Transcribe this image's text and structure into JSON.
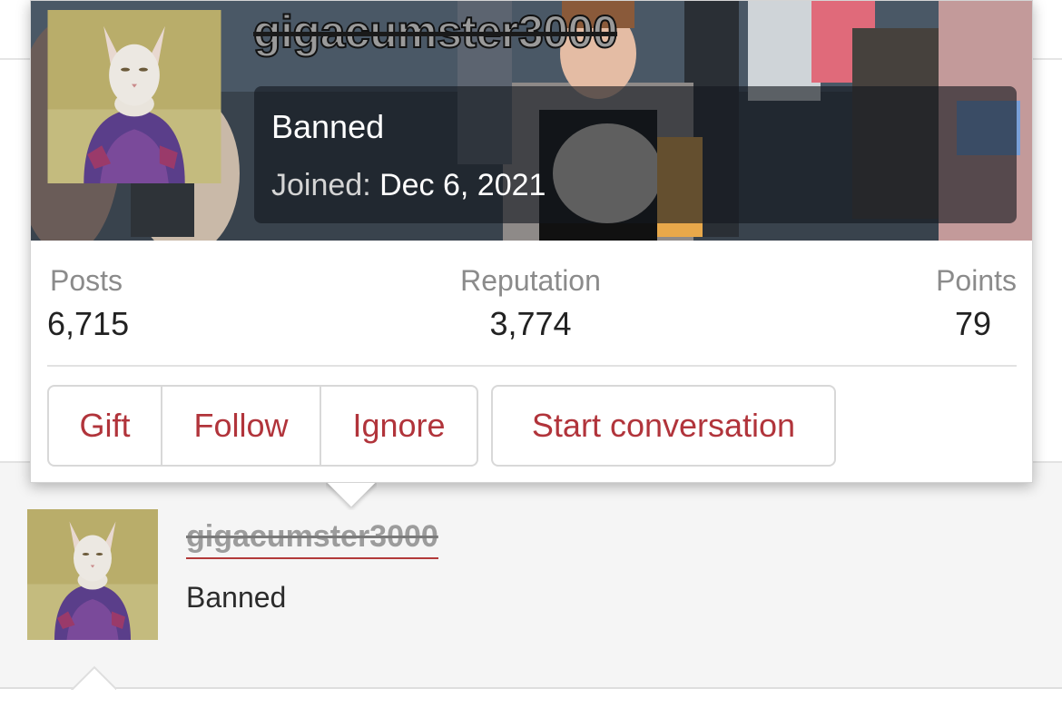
{
  "tooltip": {
    "username": "gigacumster3000",
    "status": "Banned",
    "joined_label": "Joined:",
    "joined_date": "Dec 6, 2021",
    "stats": [
      {
        "label": "Posts",
        "value": "6,715"
      },
      {
        "label": "Reputation",
        "value": "3,774"
      },
      {
        "label": "Points",
        "value": "79"
      }
    ],
    "buttons": {
      "gift": "Gift",
      "follow": "Follow",
      "ignore": "Ignore",
      "start_conversation": "Start conversation"
    }
  },
  "post": {
    "username": "gigacumster3000",
    "user_title": "Banned"
  },
  "colors": {
    "action": "#b1343b",
    "muted": "#8b8b8b",
    "username_strike": "#9a9a9a"
  },
  "icons": {
    "avatar": "cat-in-sweater-avatar",
    "banner": "profile-banner-photo"
  }
}
